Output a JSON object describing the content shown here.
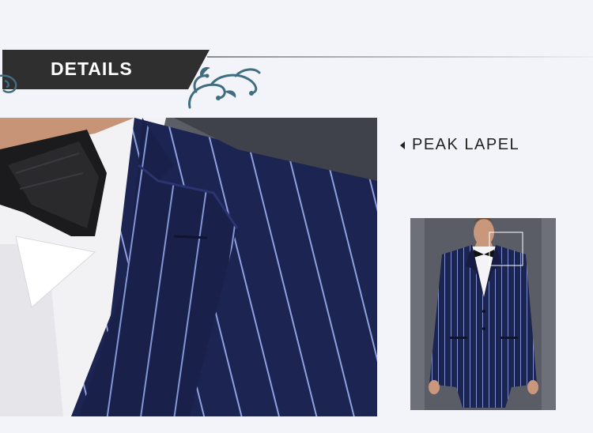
{
  "header": {
    "title": "DETAILS"
  },
  "feature": {
    "label": "PEAK LAPEL"
  },
  "images": {
    "detail_photo": "close-up of pinstripe suit peak lapel with black bow tie and white shirt collar",
    "thumbnail": "full-length model wearing navy pinstripe suit with bow tie"
  },
  "colors": {
    "background": "#f3f4f9",
    "banner": "#2f2f2f",
    "suit_navy": "#1c2451",
    "pinstripe": "#8fa0e0",
    "ornament": "#3f6e80"
  }
}
